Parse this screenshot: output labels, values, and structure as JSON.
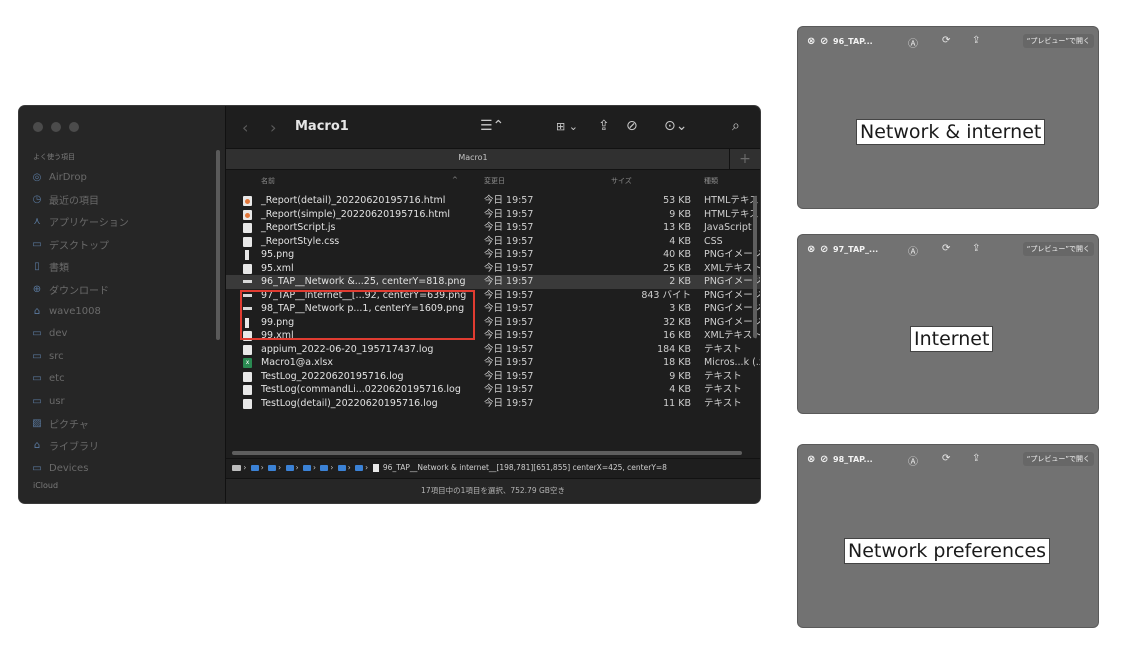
{
  "finder": {
    "title": "Macro1",
    "tab_label": "Macro1",
    "sidebar": {
      "section_label": "よく使う項目",
      "items": [
        {
          "label": "AirDrop",
          "icon": "airdrop-icon"
        },
        {
          "label": "最近の項目",
          "icon": "clock-icon"
        },
        {
          "label": "アプリケーション",
          "icon": "apps-icon"
        },
        {
          "label": "デスクトップ",
          "icon": "desktop-icon"
        },
        {
          "label": "書類",
          "icon": "document-icon"
        },
        {
          "label": "ダウンロード",
          "icon": "download-icon"
        },
        {
          "label": "wave1008",
          "icon": "home-icon"
        },
        {
          "label": "dev",
          "icon": "folder-icon"
        },
        {
          "label": "src",
          "icon": "folder-icon"
        },
        {
          "label": "etc",
          "icon": "folder-icon"
        },
        {
          "label": "usr",
          "icon": "folder-icon"
        },
        {
          "label": "ピクチャ",
          "icon": "photo-icon"
        },
        {
          "label": "ライブラリ",
          "icon": "library-icon"
        },
        {
          "label": "Devices",
          "icon": "folder-icon"
        }
      ],
      "icloud_label": "iCloud"
    },
    "columns": {
      "name": "名前",
      "date": "変更日",
      "size": "サイズ",
      "kind": "種類"
    },
    "rows": [
      {
        "name": "_Report(detail)_20220620195716.html",
        "date": "今日 19:57",
        "size": "53 KB",
        "kind": "HTMLテキスト",
        "icon": "html"
      },
      {
        "name": "_Report(simple)_20220620195716.html",
        "date": "今日 19:57",
        "size": "9 KB",
        "kind": "HTMLテキスト",
        "icon": "html"
      },
      {
        "name": "_ReportScript.js",
        "date": "今日 19:57",
        "size": "13 KB",
        "kind": "JavaScript",
        "icon": "page"
      },
      {
        "name": "_ReportStyle.css",
        "date": "今日 19:57",
        "size": "4 KB",
        "kind": "CSS",
        "icon": "page"
      },
      {
        "name": "95.png",
        "date": "今日 19:57",
        "size": "40 KB",
        "kind": "PNGイメージ",
        "icon": "tall"
      },
      {
        "name": "95.xml",
        "date": "今日 19:57",
        "size": "25 KB",
        "kind": "XMLテキスト",
        "icon": "page"
      },
      {
        "name": "96_TAP__Network &...25, centerY=818.png",
        "date": "今日 19:57",
        "size": "2 KB",
        "kind": "PNGイメージ",
        "icon": "strip",
        "selected": true
      },
      {
        "name": "97_TAP__Internet__[...92, centerY=639.png",
        "date": "今日 19:57",
        "size": "843 バイト",
        "kind": "PNGイメージ",
        "icon": "strip"
      },
      {
        "name": "98_TAP__Network p...1, centerY=1609.png",
        "date": "今日 19:57",
        "size": "3 KB",
        "kind": "PNGイメージ",
        "icon": "strip"
      },
      {
        "name": "99.png",
        "date": "今日 19:57",
        "size": "32 KB",
        "kind": "PNGイメージ",
        "icon": "tall"
      },
      {
        "name": "99.xml",
        "date": "今日 19:57",
        "size": "16 KB",
        "kind": "XMLテキスト",
        "icon": "page"
      },
      {
        "name": "appium_2022-06-20_195717437.log",
        "date": "今日 19:57",
        "size": "184 KB",
        "kind": "テキスト",
        "icon": "page"
      },
      {
        "name": "Macro1@a.xlsx",
        "date": "今日 19:57",
        "size": "18 KB",
        "kind": "Micros...k (.x",
        "icon": "xlsx"
      },
      {
        "name": "TestLog_20220620195716.log",
        "date": "今日 19:57",
        "size": "9 KB",
        "kind": "テキスト",
        "icon": "page"
      },
      {
        "name": "TestLog(commandLi...0220620195716.log",
        "date": "今日 19:57",
        "size": "4 KB",
        "kind": "テキスト",
        "icon": "page"
      },
      {
        "name": "TestLog(detail)_20220620195716.log",
        "date": "今日 19:57",
        "size": "11 KB",
        "kind": "テキスト",
        "icon": "page"
      }
    ],
    "path_text": "96_TAP__Network & internet__[198,781][651,855] centerX=425, centerY=8",
    "status": "17項目中の1項目を選択、752.79 GB空き"
  },
  "popups": [
    {
      "title": "96_TAP...",
      "open_label": "“プレビュー”で開く",
      "label": "Network & internet"
    },
    {
      "title": "97_TAP_...",
      "open_label": "“プレビュー”で開く",
      "label": "Internet"
    },
    {
      "title": "98_TAP...",
      "open_label": "“プレビュー”で開く",
      "label": "Network preferences"
    }
  ],
  "colors": {
    "highlight": "#e03c31",
    "finder_bg": "#1e1e1e",
    "popup_bg": "#727272"
  }
}
